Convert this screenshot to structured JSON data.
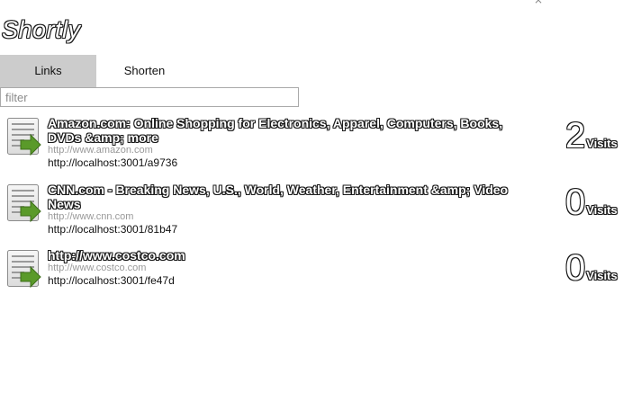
{
  "app": {
    "title": "Shortly"
  },
  "tabs": [
    {
      "label": "Links",
      "active": true
    },
    {
      "label": "Shorten",
      "active": false
    }
  ],
  "filter": {
    "placeholder": "filter",
    "value": ""
  },
  "links": [
    {
      "title": "Amazon.com: Online Shopping for Electronics, Apparel, Computers, Books, DVDs &amp; more",
      "origin": "http://www.amazon.com",
      "short_url": "http://localhost:3001/a9736",
      "visits": "2",
      "visits_label": "Visits",
      "icon": "document-arrow-icon"
    },
    {
      "title": "CNN.com - Breaking News, U.S., World, Weather, Entertainment &amp; Video News",
      "origin": "http://www.cnn.com",
      "short_url": "http://localhost:3001/81b47",
      "visits": "0",
      "visits_label": "Visits",
      "icon": "document-arrow-icon"
    },
    {
      "title": "http://www.costco.com",
      "origin": "http://www.costco.com",
      "short_url": "http://localhost:3001/fe47d",
      "visits": "0",
      "visits_label": "Visits",
      "icon": "document-arrow-icon"
    }
  ],
  "colors": {
    "active_tab_bg": "#cccccc",
    "origin_text": "#999999",
    "icon_arrow": "#5a9a2a"
  }
}
